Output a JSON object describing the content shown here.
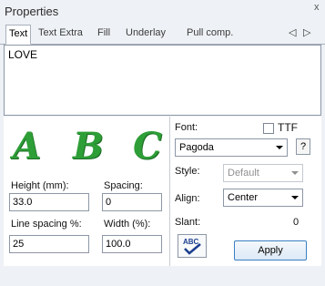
{
  "window": {
    "title": "Properties",
    "close_symbol": "x"
  },
  "tabs": [
    {
      "label": "Text"
    },
    {
      "label": "Text Extra"
    },
    {
      "label": "Fill"
    },
    {
      "label": "Underlay"
    },
    {
      "label": "Pull comp."
    }
  ],
  "tab_nav": {
    "prev": "◁",
    "next": "▷"
  },
  "text_content": "LOVE",
  "preview": {
    "letters": [
      "A",
      "B",
      "C"
    ],
    "color": "#2e9e37"
  },
  "fields": {
    "height_label": "Height (mm):",
    "height_value": "33.0",
    "spacing_label": "Spacing:",
    "spacing_value": "0",
    "line_spacing_label": "Line spacing %:",
    "line_spacing_value": "25",
    "width_label": "Width (%):",
    "width_value": "100.0"
  },
  "font": {
    "label": "Font:",
    "ttf_label": "TTF",
    "value": "Pagoda",
    "help": "?"
  },
  "style": {
    "label": "Style:",
    "value": "Default"
  },
  "align": {
    "label": "Align:",
    "value": "Center"
  },
  "slant": {
    "label": "Slant:",
    "value": "0"
  },
  "apply_label": "Apply",
  "icons": {
    "spellcheck": "abc-spellcheck-icon"
  }
}
